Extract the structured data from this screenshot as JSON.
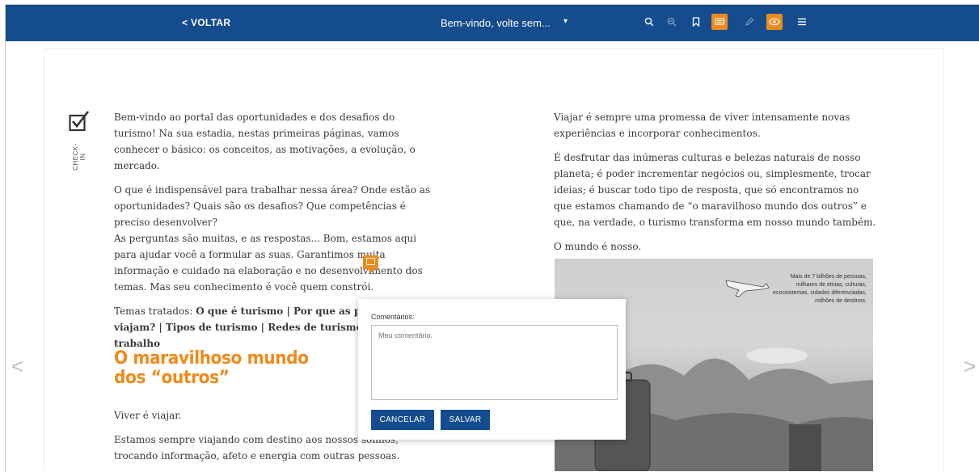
{
  "toolbar": {
    "back_label": "< VOLTAR",
    "document_title": "Bem-vindo, volte sem...",
    "caret": "▾",
    "icons": [
      "search-icon",
      "zoom-out-icon",
      "bookmark-icon",
      "comments-icon",
      "pencil-icon",
      "eye-icon",
      "menu-icon"
    ],
    "accent": "#ef8a1c",
    "bar_color": "#144c8e"
  },
  "nav": {
    "prev": "<",
    "next": ">"
  },
  "checkin": {
    "label": "CHECK-IN"
  },
  "left_column": {
    "p1": "Bem-vindo ao portal das oportunidades e dos desafios do turismo! Na sua estadia, nestas primeiras páginas, vamos conhecer o básico: os conceitos, as motivações, a evolução, o mercado.",
    "p2": "O que é indispensável para trabalhar nessa área? Onde estão as oportunidades? Quais são os desafios? Que competências é preciso desenvolver?",
    "p3": "As perguntas são muitas, e as respostas... Bom, estamos aqui para ajudar você a formular as suas. Garantimos muita informação e cuidado na elaboração e no desenvolvimento dos temas. Mas seu conhecimento é você quem constrói.",
    "p4_prefix": "Temas tratados: ",
    "p4_bold": "O que é turismo | Por que as pessoas viajam? | Tipos de turismo | Redes de turismo | Mercado de trabalho",
    "heading": "O maravilhoso mundo dos “outros”",
    "p5": "Viver é viajar.",
    "p6": "Estamos sempre viajando com destino aos nossos sonhos, trocando informação, afeto e energia com outras pessoas."
  },
  "right_column": {
    "p1": "Viajar é sempre uma promessa de viver intensamente novas experiências e incorporar conhecimentos.",
    "p2": "É desfrutar das inúmeras culturas e belezas naturais de nosso planeta; é poder incrementar negócios ou, simplesmente, trocar ideias; é buscar todo tipo de resposta, que só encontramos no que estamos chamando de “o maravilhoso mundo dos outros” e que, na verdade, o turismo transforma em nosso mundo também.",
    "p3": "O mundo é nosso.",
    "illustration_caption": "Mais de 7 bilhões de pessoas, milhares de etnias, culturas, ecossistemas, cidades diferenciadas, milhões de destinos."
  },
  "comment_popup": {
    "label": "Comentários:",
    "placeholder": "Meu comentário.",
    "cancel_label": "CANCELAR",
    "save_label": "SALVAR"
  }
}
